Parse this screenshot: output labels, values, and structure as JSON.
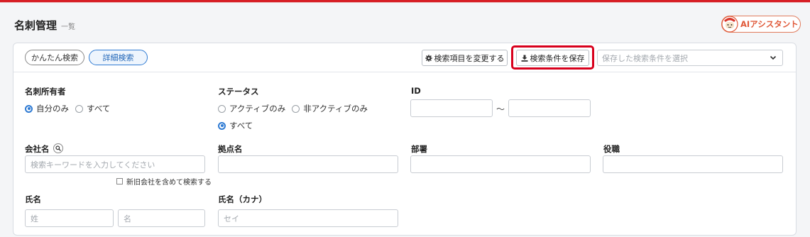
{
  "header": {
    "title": "名刺管理",
    "subtitle": "一覧",
    "ai_assistant_label": "AIアシスタント"
  },
  "toolbar": {
    "simple_search": "かんたん検索",
    "detail_search": "詳細検索",
    "change_items": "検索項目を変更する",
    "save_conditions": "検索条件を保存",
    "saved_conditions_placeholder": "保存した検索条件を選択"
  },
  "form": {
    "owner": {
      "label": "名刺所有者",
      "options": [
        "自分のみ",
        "すべて"
      ],
      "selected": "自分のみ"
    },
    "status": {
      "label": "ステータス",
      "options": [
        "アクティブのみ",
        "非アクティブのみ",
        "すべて"
      ],
      "selected": "すべて"
    },
    "id": {
      "label": "ID",
      "separator": "～"
    },
    "company": {
      "label": "会社名",
      "placeholder": "検索キーワードを入力してください",
      "checkbox_label": "新旧会社を含めて検索する"
    },
    "branch": {
      "label": "拠点名"
    },
    "department": {
      "label": "部署"
    },
    "position": {
      "label": "役職"
    },
    "name": {
      "label": "氏名",
      "last_placeholder": "姓",
      "first_placeholder": "名"
    },
    "name_kana": {
      "label": "氏名（カナ）",
      "placeholder": "セイ"
    }
  },
  "colors": {
    "accent_blue": "#2f7bd3",
    "highlight_red": "#d8001c",
    "top_bar_red": "#d71f25"
  }
}
